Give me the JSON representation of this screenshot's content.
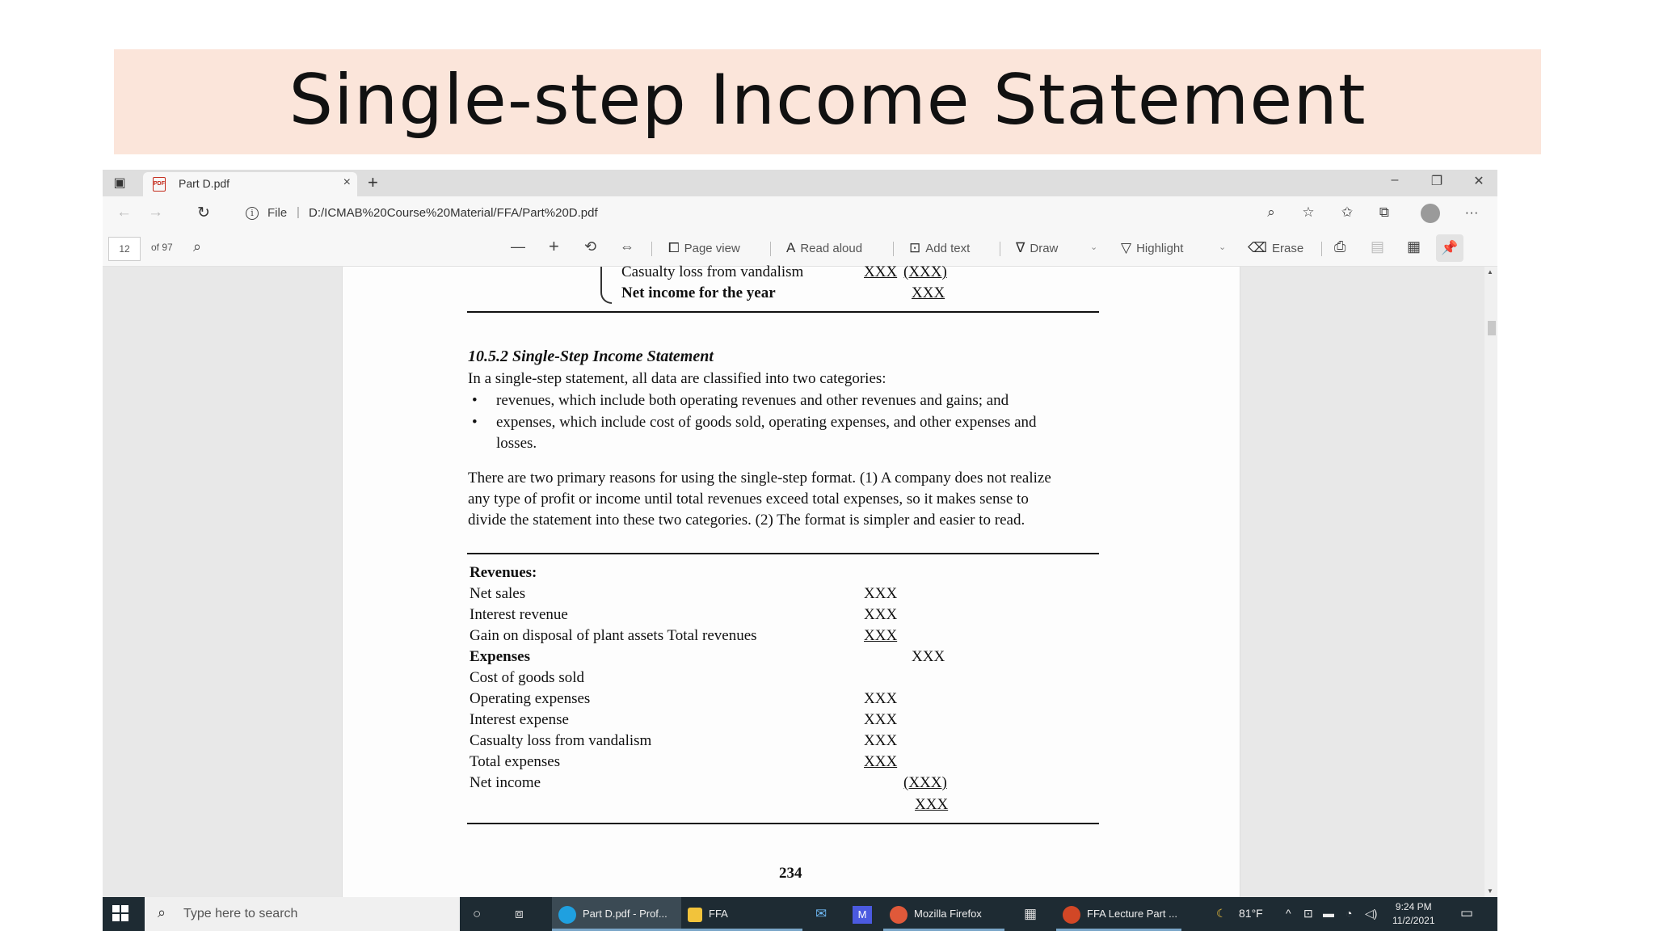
{
  "slide": {
    "title": "Single-step Income Statement"
  },
  "browser": {
    "tab_title": "Part D.pdf",
    "tab_close": "×",
    "new_tab": "+",
    "win_min": "–",
    "win_restore": "❐",
    "win_close": "✕",
    "file_label": "File",
    "url_sep": "|",
    "url": "D:/ICMAB%20Course%20Material/FFA/Part%20D.pdf",
    "more": "···"
  },
  "pdf_toolbar": {
    "page_number": "12",
    "page_of": "of 97",
    "zoom_out": "—",
    "zoom_in": "+",
    "page_view": "Page view",
    "read_aloud": "Read aloud",
    "add_text": "Add text",
    "draw": "Draw",
    "highlight": "Highlight",
    "erase": "Erase"
  },
  "document": {
    "prev_row1_label": "Casualty loss from vandalism",
    "prev_row1_val1": "XXX",
    "prev_row1_val2": "(XXX)",
    "prev_row2_label": "Net income for the year",
    "prev_row2_val": "XXX",
    "section_heading": "10.5.2 Single-Step Income Statement",
    "intro": "In a single-step statement, all data are classified into two categories:",
    "bullets": [
      "revenues, which include both operating revenues and other revenues and gains; and",
      "expenses, which include cost of goods sold, operating expenses, and other expenses and",
      "losses."
    ],
    "paragraph_lines": [
      "There are two primary reasons for using the single-step format. (1) A company does not realize",
      "any type of profit or income until total revenues exceed total expenses, so it makes sense to",
      "divide the statement into these two categories. (2) The format is simpler and easier to read."
    ],
    "statement": {
      "revenues_heading": "Revenues:",
      "net_sales": "Net sales",
      "interest_revenue": "Interest revenue",
      "gain_disposal": "Gain on disposal of plant assets Total revenues",
      "expenses_heading": "Expenses",
      "cost_of_goods_sold": "Cost of goods sold",
      "operating_expenses": "Operating expenses",
      "interest_expense": "Interest expense",
      "casualty_loss": "Casualty loss from vandalism",
      "total_expenses": "Total expenses",
      "net_income": "Net income",
      "xxx": "XXX",
      "neg_xxx": "(XXX)"
    },
    "page_footer": "234"
  },
  "taskbar": {
    "search_placeholder": "Type here to search",
    "apps": [
      {
        "label": "Part D.pdf - Prof...",
        "color": "#1fa0e0"
      },
      {
        "label": "FFA",
        "color": "#f2c33b"
      },
      {
        "label": "Mozilla Firefox",
        "color": "#e0593a"
      },
      {
        "label": "FFA Lecture Part ...",
        "color": "#d24726"
      }
    ],
    "weather": "81°F",
    "time": "9:24 PM",
    "date": "11/2/2021"
  }
}
